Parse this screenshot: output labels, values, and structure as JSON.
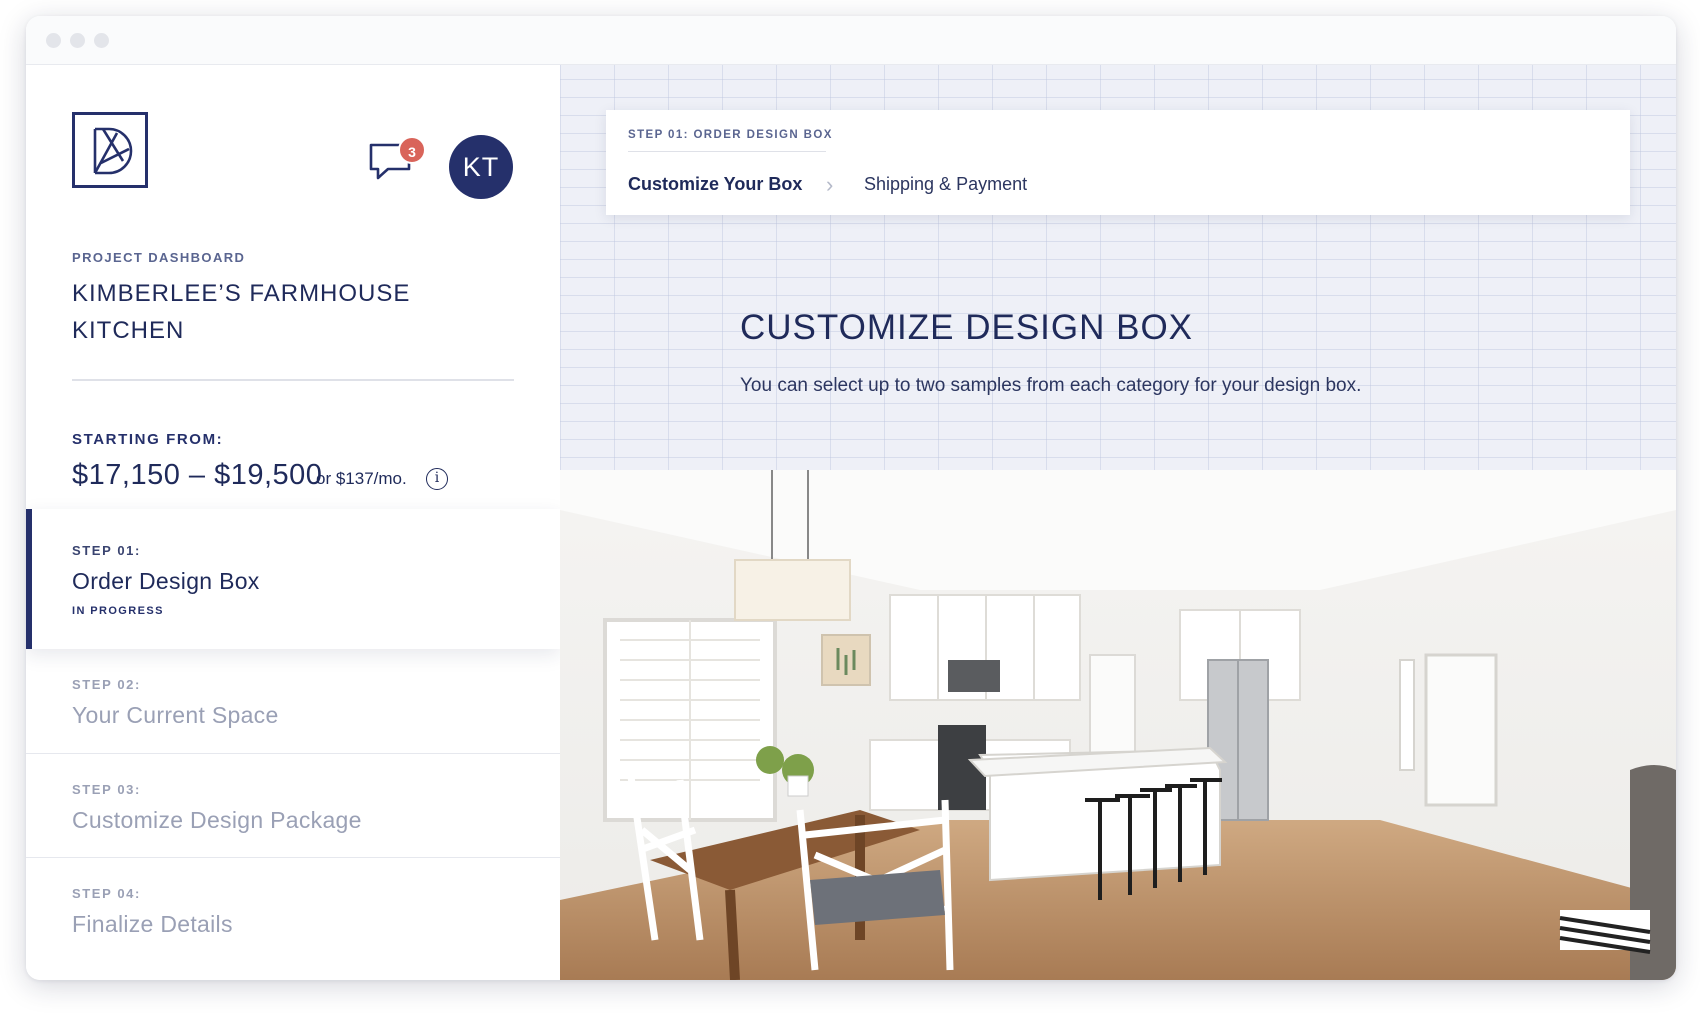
{
  "header": {
    "notification_count": "3",
    "avatar_initials": "KT"
  },
  "project": {
    "label": "PROJECT DASHBOARD",
    "title": "KIMBERLEE’S FARMHOUSE KITCHEN",
    "starting_label": "STARTING FROM:",
    "price_range": "$17,150 – $19,500",
    "monthly": "or $137/mo.",
    "info_icon": "i"
  },
  "steps": [
    {
      "num": "STEP 01:",
      "title": "Order Design Box",
      "status": "IN PROGRESS"
    },
    {
      "num": "STEP 02:",
      "title": "Your Current Space"
    },
    {
      "num": "STEP 03:",
      "title": "Customize Design Package"
    },
    {
      "num": "STEP 04:",
      "title": "Finalize Details"
    }
  ],
  "step_card": {
    "eyebrow": "STEP 01: ORDER DESIGN BOX",
    "crumbs": [
      "Customize Your Box",
      "Shipping & Payment"
    ],
    "chevron": "›"
  },
  "main": {
    "title": "CUSTOMIZE DESIGN BOX",
    "subtitle": "You can select up to two samples from each category for your design box."
  },
  "colors": {
    "brand_navy": "#25306b",
    "badge_red": "#d9645a",
    "pattern_bg": "#eef0f7"
  },
  "icons": {
    "logo": "db-monogram-logo",
    "chat": "chat-bubble-icon",
    "info": "info-icon",
    "chevron": "chevron-right-icon"
  }
}
